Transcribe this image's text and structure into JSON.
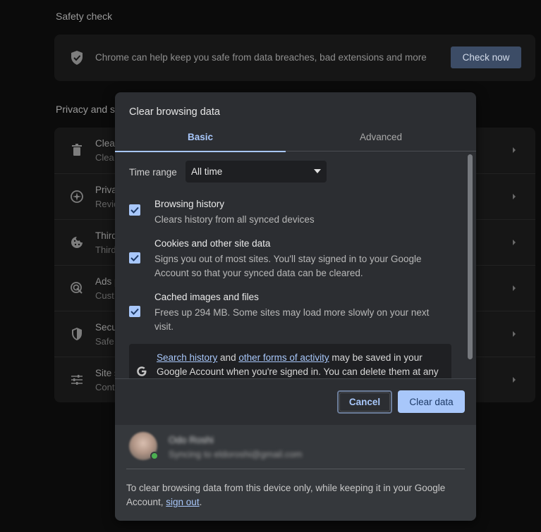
{
  "background": {
    "safety_title": "Safety check",
    "safety_text": "Chrome can help keep you safe from data breaches, bad extensions and more",
    "check_now": "Check now",
    "privacy_title": "Privacy and s",
    "rows": [
      {
        "title": "Clea",
        "sub": "Clea",
        "icon": "trash-icon"
      },
      {
        "title": "Priva",
        "sub": "Revie",
        "icon": "compass-icon"
      },
      {
        "title": "Third",
        "sub": "Third",
        "icon": "cookie-icon"
      },
      {
        "title": "Ads p",
        "sub": "Cust",
        "icon": "ads-icon"
      },
      {
        "title": "Secu",
        "sub": "Safe",
        "icon": "shield-icon"
      },
      {
        "title": "Site s",
        "sub": "Cont",
        "icon": "sliders-icon"
      }
    ]
  },
  "dialog": {
    "title": "Clear browsing data",
    "tabs": [
      "Basic",
      "Advanced"
    ],
    "time_range_label": "Time range",
    "time_range_value": "All time",
    "options": [
      {
        "title": "Browsing history",
        "desc": "Clears history from all synced devices",
        "checked": true
      },
      {
        "title": "Cookies and other site data",
        "desc": "Signs you out of most sites. You'll stay signed in to your Google Account so that your synced data can be cleared.",
        "checked": true
      },
      {
        "title": "Cached images and files",
        "desc": "Frees up 294 MB. Some sites may load more slowly on your next visit.",
        "checked": true
      }
    ],
    "notice": {
      "link1": "Search history",
      "and": " and ",
      "link2": "other forms of activity",
      "rest": " may be saved in your Google Account when you're signed in. You can delete them at any"
    },
    "cancel": "Cancel",
    "clear": "Clear data",
    "account": {
      "name": "Odo Roshi",
      "sync": "Syncing to eldoroshi@gmail.com"
    },
    "footer_text": "To clear browsing data from this device only, while keeping it in your Google Account, ",
    "footer_link": "sign out",
    "footer_end": ".",
    "colors": {
      "accent": "#a8c7fa",
      "dialog_bg": "#2c2e32",
      "footer_bg": "#35383c"
    }
  }
}
